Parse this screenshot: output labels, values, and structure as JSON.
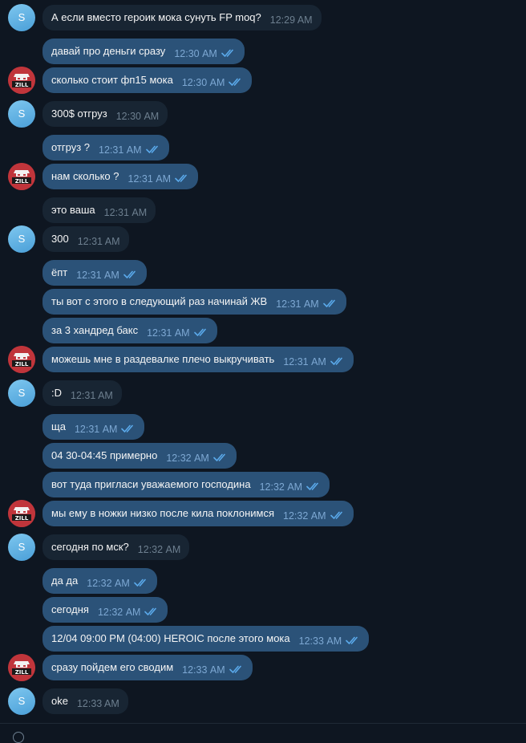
{
  "avatars": {
    "s_initial": "S",
    "zill_logo_text": "ZILL"
  },
  "messages": [
    {
      "dir": "in",
      "avatar": "s",
      "text": "А если вместо героик мока сунуть FP moq?",
      "time": "12:29 AM"
    },
    {
      "dir": "out",
      "avatar": null,
      "text": "давай про деньги сразу",
      "time": "12:30 AM",
      "read": true
    },
    {
      "dir": "out",
      "avatar": "zill",
      "text": "сколько стоит фп15 мока",
      "time": "12:30 AM",
      "read": true
    },
    {
      "dir": "in",
      "avatar": "s",
      "text": "300$ отгруз",
      "time": "12:30 AM"
    },
    {
      "dir": "out",
      "avatar": null,
      "text": "отгруз ?",
      "time": "12:31 AM",
      "read": true
    },
    {
      "dir": "out",
      "avatar": "zill",
      "text": "нам сколько ?",
      "time": "12:31 AM",
      "read": true
    },
    {
      "dir": "in",
      "avatar": null,
      "text": "это ваша",
      "time": "12:31 AM"
    },
    {
      "dir": "in",
      "avatar": "s",
      "text": "300",
      "time": "12:31 AM"
    },
    {
      "dir": "out",
      "avatar": null,
      "text": "ёпт",
      "time": "12:31 AM",
      "read": true
    },
    {
      "dir": "out",
      "avatar": null,
      "text": "ты вот с этого в следующий раз начинай ЖВ",
      "time": "12:31 AM",
      "read": true
    },
    {
      "dir": "out",
      "avatar": null,
      "text": "за 3 хандред бакс",
      "time": "12:31 AM",
      "read": true
    },
    {
      "dir": "out",
      "avatar": "zill",
      "text": "можешь мне в раздевалке плечо выкручивать",
      "time": "12:31 AM",
      "read": true
    },
    {
      "dir": "in",
      "avatar": "s",
      "text": ":D",
      "time": "12:31 AM"
    },
    {
      "dir": "out",
      "avatar": null,
      "text": "ща",
      "time": "12:31 AM",
      "read": true
    },
    {
      "dir": "out",
      "avatar": null,
      "text": "04 30-04:45 примерно",
      "time": "12:32 AM",
      "read": true
    },
    {
      "dir": "out",
      "avatar": null,
      "text": "вот туда пригласи уважаемого господина",
      "time": "12:32 AM",
      "read": true
    },
    {
      "dir": "out",
      "avatar": "zill",
      "text": "мы ему в ножки низко после кила поклонимся",
      "time": "12:32 AM",
      "read": true
    },
    {
      "dir": "in",
      "avatar": "s",
      "text": "сегодня по мск?",
      "time": "12:32 AM"
    },
    {
      "dir": "out",
      "avatar": null,
      "text": "да да",
      "time": "12:32 AM",
      "read": true
    },
    {
      "dir": "out",
      "avatar": null,
      "text": "сегодня",
      "time": "12:32 AM",
      "read": true
    },
    {
      "dir": "out",
      "avatar": null,
      "text": "12/04 09:00 PM (04:00) HEROIC после этого мока",
      "time": "12:33 AM",
      "read": true
    },
    {
      "dir": "out",
      "avatar": "zill",
      "text": "сразу пойдем его сводим",
      "time": "12:33 AM",
      "read": true
    },
    {
      "dir": "in",
      "avatar": "s",
      "text": "oke",
      "time": "12:33 AM"
    }
  ]
}
